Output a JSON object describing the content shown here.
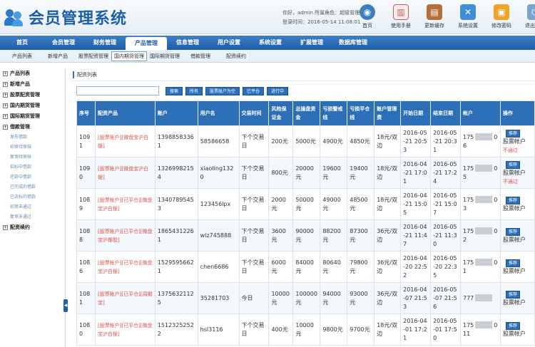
{
  "app": {
    "title": "会员管理系统",
    "user_line": "你好，admin  所属角色：超级管理员",
    "login_line": "登录时间：2016-05-14 11:08:01"
  },
  "toolbar": [
    {
      "label": "首页",
      "icon": "globe-icon",
      "glyph": "◉"
    },
    {
      "label": "使用手册",
      "icon": "chart-icon",
      "glyph": "▥"
    },
    {
      "label": "更新缓存",
      "icon": "book-icon",
      "glyph": "▤"
    },
    {
      "label": "系统设置",
      "icon": "tools-icon",
      "glyph": "✕"
    },
    {
      "label": "修改密码",
      "icon": "folder-icon",
      "glyph": "▣"
    },
    {
      "label": "退出后台",
      "icon": "power-icon",
      "glyph": "⏻"
    }
  ],
  "mainnav": [
    "首页",
    "会员管理",
    "财务管理",
    "产品管理",
    "信息管理",
    "用户设置",
    "系统设置",
    "扩展管理",
    "数据库管理"
  ],
  "mainnav_active": 3,
  "subnav": [
    "产品列表",
    "新增产品",
    "股票配资管理",
    "国内期货管理",
    "国际期货管理",
    "借款管理",
    "配资续约"
  ],
  "subnav_active": 3,
  "sidebar": [
    {
      "type": "group",
      "label": "产品列表"
    },
    {
      "type": "group",
      "label": "新增产品"
    },
    {
      "type": "group",
      "label": "股票配资管理"
    },
    {
      "type": "group",
      "label": "国内期货管理"
    },
    {
      "type": "group",
      "label": "国际期货管理"
    },
    {
      "type": "group",
      "label": "借款管理"
    },
    {
      "type": "item",
      "label": "发布借款"
    },
    {
      "type": "item",
      "label": "初审待审核"
    },
    {
      "type": "item",
      "label": "复审待审核"
    },
    {
      "type": "item",
      "label": "招标中借款"
    },
    {
      "type": "item",
      "label": "还款中借款"
    },
    {
      "type": "item",
      "label": "已完成的借款"
    },
    {
      "type": "item",
      "label": "已流标的借款"
    },
    {
      "type": "item",
      "label": "初审未通过"
    },
    {
      "type": "item",
      "label": "复审未通过"
    },
    {
      "type": "group",
      "label": "配资续约"
    }
  ],
  "panel": {
    "title": "配资列表"
  },
  "search": {
    "placeholder": "",
    "buttons": [
      "搜索",
      "所有",
      "股票账户为空",
      "已平仓",
      "进行中"
    ]
  },
  "table": {
    "headers": [
      "序号",
      "配资产品",
      "账户",
      "用户名",
      "交易时间",
      "风险保证金",
      "总操盘资金",
      "亏损警戒线",
      "亏损平仓线",
      "账户管理费",
      "开始日期",
      "结束日期",
      "帐户",
      "操作"
    ],
    "rows": [
      {
        "id": "1091",
        "product": "[股票账户][微盘宝沪白银]",
        "phone": "13988583361",
        "user": "58586658",
        "time": "下个交易日",
        "margin": "200元",
        "total": "5000元",
        "warn": "4900元",
        "close": "4850元",
        "fee": "18元/双边",
        "start": "2016-05-21 20:53",
        "end": "2016-05-21 20:31",
        "acct_a": "175",
        "acct_b": "06",
        "op_btn": "推荐",
        "op_line": "股票帐户",
        "op_red": "不通过"
      },
      {
        "id": "1090",
        "product": "[股票帐户][微盘宝沪白银]",
        "phone": "13269982154",
        "user": "xiaoling1320",
        "time": "下个交易日",
        "margin": "800元",
        "total": "20000元",
        "warn": "19600元",
        "close": "19400元",
        "fee": "18元/双边",
        "start": "2016-04-21 17:01",
        "end": "2016-05-21 17:24",
        "acct_a": "175",
        "acct_b": "05",
        "op_btn": "推荐",
        "op_line": "股票帐户",
        "op_red": "不通过"
      },
      {
        "id": "1089",
        "product": "[股票帐户][已平仓][微盘宝沪白银]",
        "phone": "13407895453",
        "user": "123456lpx",
        "time": "下个交易日",
        "margin": "2000元",
        "total": "50000元",
        "warn": "49000元",
        "close": "48500元",
        "fee": "18元/双边",
        "start": "2016-04-21 15:05",
        "end": "2016-05-21 15:07",
        "acct_a": "175",
        "acct_b": "03",
        "op_btn": "推荐",
        "op_line": "股票帐户",
        "op_red": ""
      },
      {
        "id": "1088",
        "product": "[股票帐户][已平仓][微盘宝沪橡胶]",
        "phone": "18654312261",
        "user": "wlz745888",
        "time": "下个交易日",
        "margin": "3600元",
        "total": "90000元",
        "warn": "88200元",
        "close": "87300元",
        "fee": "36元/双边",
        "start": "2016-04-21 11:47",
        "end": "2016-05-21 11:30",
        "acct_a": "175",
        "acct_b": "02",
        "op_btn": "推荐",
        "op_line": "股票帐户",
        "op_red": ""
      },
      {
        "id": "1086",
        "product": "[股票帐户][已平仓][微盘宝沪白银]",
        "phone": "15295956621",
        "user": "chen6686",
        "time": "下个交易日",
        "margin": "6000元",
        "total": "84000元",
        "warn": "80640元",
        "close": "79800元",
        "fee": "36元/双边",
        "start": "2016-04-20 22:52",
        "end": "2016-05-20 22:35",
        "acct_a": "175",
        "acct_b": "01",
        "op_btn": "推荐",
        "op_line": "股票帐户",
        "op_red": ""
      },
      {
        "id": "1081",
        "product": "[股票帐户][已平仓][周期宝]",
        "phone": "13756321125",
        "user": "35281703",
        "time": "今日",
        "margin": "10000元",
        "total": "100000元",
        "warn": "94000元",
        "close": "93000元",
        "fee": "36元/双边",
        "start": "2016-04-07 21:53",
        "end": "2016-05-07 21:56",
        "acct_a": "777",
        "acct_b": "",
        "op_btn": "推荐",
        "op_line": "股票帐户",
        "op_red": ""
      },
      {
        "id": "1080",
        "product": "[股票帐户][已平仓][微盘宝沪白银]",
        "phone": "15123252522",
        "user": "hsl3116",
        "time": "下个交易日",
        "margin": "400元",
        "total": "10000元",
        "warn": "9800元",
        "close": "9700元",
        "fee": "18元/双边",
        "start": "2016-04-01 17:21",
        "end": "2016-05-01 17:50",
        "acct_a": "175",
        "acct_b": "011",
        "op_btn": "推荐",
        "op_line": "股票帐户",
        "op_red": ""
      }
    ]
  }
}
